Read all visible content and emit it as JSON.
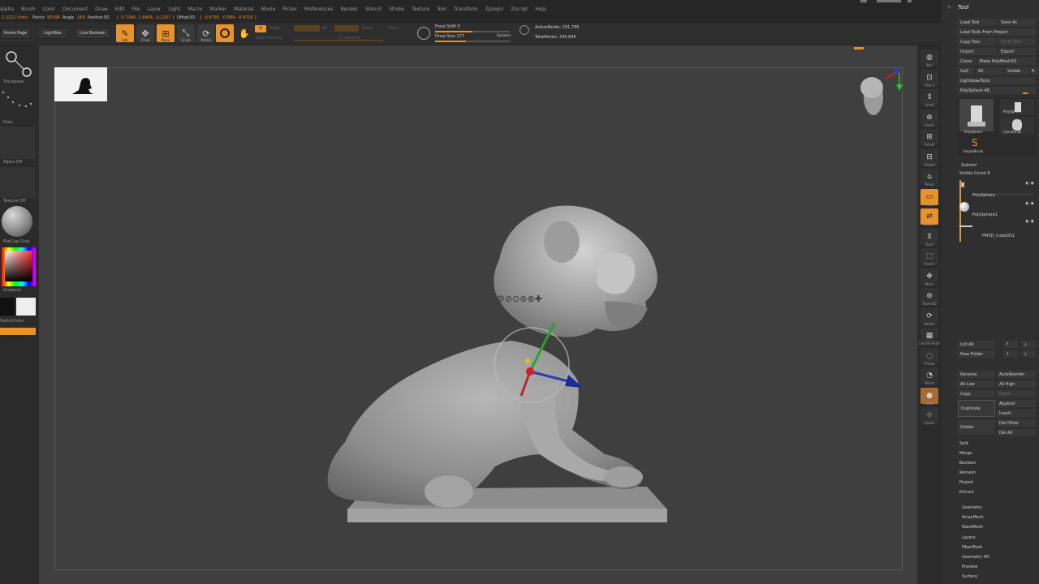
{
  "menubar": {
    "items": [
      "Alpha",
      "Brush",
      "Color",
      "Document",
      "Draw",
      "Edit",
      "File",
      "Layer",
      "Light",
      "Macro",
      "Marker",
      "Material",
      "Movie",
      "Picker",
      "Preferences",
      "Render",
      "Stencil",
      "Stroke",
      "Texture",
      "Tool",
      "Transform",
      "Zplugin",
      "Zscript",
      "Help"
    ]
  },
  "infobar": {
    "scale": "1.1221 Units",
    "points_label": "Points",
    "points_value": "90598",
    "angle_label": "Angle",
    "angle_value": "169",
    "position_label": "Position3D",
    "position_value": "{ -0.7346, 1.4408, -0.2207 }",
    "offset_label": "Offset3D",
    "offset_value": "{ -0.6785, -0.884, -0.4726 }"
  },
  "shelf": {
    "home_page": "Home Page",
    "lightbox": "LightBox",
    "live_boolean": "Live Boolean",
    "edit": "Edit",
    "draw": "Draw",
    "move": "Move",
    "scale": "Scale",
    "rotate": "Rotate",
    "a_label": "A",
    "mrgb": "Mrgb",
    "rgb": "Rgb",
    "m": "M",
    "rgb_intensity": "Rgb Intensity",
    "zadd": "Zadd",
    "zsub": "Zsub",
    "zcut": "Zcut",
    "z_intensity": "Z Intensity",
    "focal_shift": "Focal Shift 0",
    "draw_size": "Draw Size 177",
    "dynamic": "Dynamic",
    "active_points": "ActivePoints: 201,795",
    "total_points": "TotalPoints: 245,645"
  },
  "leftshelf": {
    "transpose": "Transpose",
    "dots": "Dots",
    "alpha_off": "Alpha Off",
    "texture_off": "Texture Off",
    "matcap": "MatCap Gray",
    "gradient": "Gradient",
    "switchcolor": "SwitchColor",
    "alternate": "Alternate"
  },
  "rightshelf": {
    "labels": [
      "Bpr",
      "SPix 3",
      "Scroll",
      "Zoom",
      "Actual",
      "AAHalf",
      "Persp",
      "Floor",
      "L.Sym",
      "Qxyz",
      "Frame",
      "Move",
      "Zoom3D",
      "Rotate",
      "Line Fill PolyF",
      "Transp",
      "Ghost",
      "Solo",
      "Xpose"
    ]
  },
  "tool": {
    "title": "Tool",
    "load_tool": "Load Tool",
    "save_as": "Save As",
    "load_tools_from_project": "Load Tools From Project",
    "copy_tool": "Copy Tool",
    "paste_tool": "Paste Tool",
    "import": "Import",
    "export": "Export",
    "clone": "Clone",
    "make_polymesh": "Make PolyMesh3D",
    "goz": "GoZ",
    "all": "All",
    "visible": "Visible",
    "r": "R",
    "lightbox_tools": "Lightbox▸Tools",
    "polysphere_slider": "PolySphere  48",
    "thumbs": [
      "PolySphere",
      "PolySphere",
      "PolySphere",
      "Cylinder3D",
      "SimpleBrush"
    ],
    "subtool_header": "Subtool",
    "visible_count": "Visible Count 8",
    "subtools": [
      "PolySphere",
      "PolySphere1",
      "PM3D_Cube3D1"
    ],
    "list_all": "List All",
    "new_folder": "New Folder",
    "rename": "Rename",
    "autoreorder": "AutoReorder",
    "all_low": "All Low",
    "all_high": "All High",
    "copy": "Copy",
    "paste": "Paste",
    "duplicate": "Duplicate",
    "append": "Append",
    "insert": "Insert",
    "delete": "Delete",
    "del_other": "Del Other",
    "del_all": "Del All",
    "split": "Split",
    "merge": "Merge",
    "boolean": "Boolean",
    "remesh": "Remesh",
    "project": "Project",
    "extract": "Extract",
    "sections": [
      "Geometry",
      "ArrayMesh",
      "NanoMesh",
      "Layers",
      "FiberMesh",
      "Geometry HD",
      "Preview",
      "Surface"
    ]
  },
  "colors": {
    "accent": "#e8922c",
    "viewport_bg": "#3f3f3f",
    "panel_bg": "#2f2f2f"
  }
}
